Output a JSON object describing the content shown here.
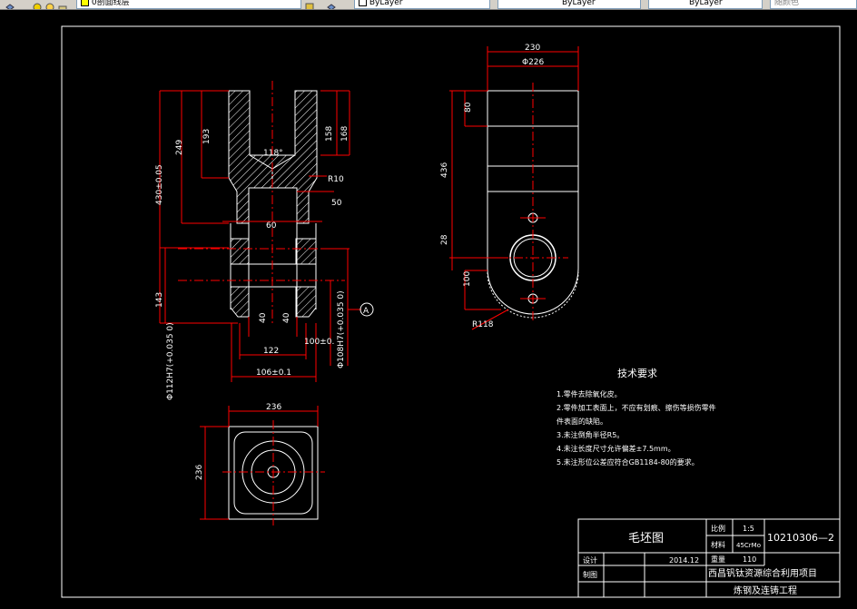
{
  "toolbar": {
    "layer_name": "0剖面线层",
    "color": "ByLayer",
    "linetype": "ByLayer",
    "lineweight": "ByLayer",
    "plotstyle": "随颜色"
  },
  "dimensions": {
    "d230": "230",
    "d226": "Φ226",
    "d80": "80",
    "d436": "436",
    "d28": "28",
    "d100": "100",
    "r118": "R118",
    "d249": "249",
    "d193": "193",
    "d430": "430±0.05",
    "d118deg": "118°",
    "d158": "158",
    "d168": "168",
    "r10": "R10",
    "d50": "50",
    "d60": "60",
    "d143": "143",
    "d40a": "40",
    "d40b": "40",
    "d100tol": "100±0.",
    "d122": "122",
    "d106": "106±0.1",
    "phi112": "Φ112H7(+0.035 0)",
    "phi108": "Φ108H7(+0.035 0)",
    "datum_a": "A",
    "d236h": "236",
    "d236v": "236"
  },
  "tech_requirements": {
    "title": "技术要求",
    "lines": [
      "1.零件去除氧化皮。",
      "2.零件加工表面上，不应有划痕、擦伤等损伤零件",
      "件表面的缺陷。",
      "3.未注倒角半径R5。",
      "4.未注长度尺寸允许偏差±7.5mm。",
      "5.未注形位公差应符合GB1184-80的要求。"
    ]
  },
  "title_block": {
    "name": "毛坯图",
    "scale_label": "比例",
    "scale_value": "1:5",
    "drawing_no": "10210306—2",
    "material_label": "材料",
    "material_value": "45CrMo",
    "weight_label": "重量",
    "weight_value": "110",
    "design_label": "设计",
    "date": "2014.12",
    "check_label": "制图",
    "project_line1": "西昌钒钛资源综合利用项目",
    "project_line2": "炼钢及连铸工程"
  }
}
